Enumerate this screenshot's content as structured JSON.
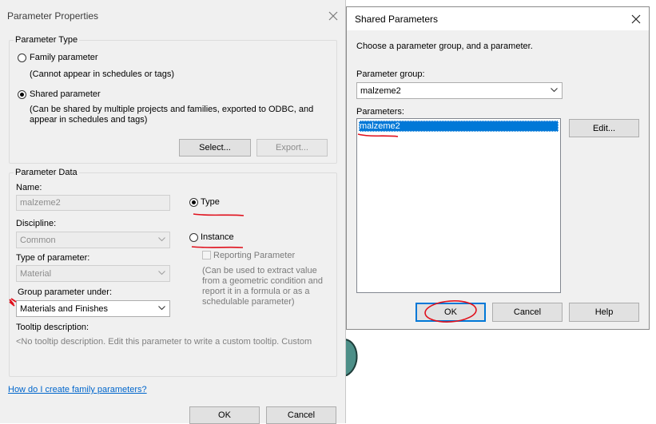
{
  "parameter_properties": {
    "title": "Parameter Properties",
    "parameter_type": {
      "legend": "Parameter Type",
      "family_label": "Family parameter",
      "family_note": "(Cannot appear in schedules or tags)",
      "shared_label": "Shared parameter",
      "shared_note_line1": "(Can be shared by multiple projects and families, exported to ODBC, and",
      "shared_note_line2": "appear in schedules and tags)",
      "selected": "shared",
      "select_button": "Select...",
      "export_button": "Export..."
    },
    "parameter_data": {
      "legend": "Parameter Data",
      "name_label": "Name:",
      "name_value": "malzeme2",
      "discipline_label": "Discipline:",
      "discipline_value": "Common",
      "type_of_parameter_label": "Type of parameter:",
      "type_of_parameter_value": "Material",
      "group_under_label": "Group parameter under:",
      "group_under_value": "Materials and Finishes",
      "tooltip_label": "Tooltip description:",
      "tooltip_value": "<No tooltip description. Edit this parameter to write a custom tooltip. Custom",
      "type_label": "Type",
      "instance_label": "Instance",
      "selected": "type",
      "reporting_label": "Reporting Parameter",
      "reporting_note_line1": "(Can be used to extract value",
      "reporting_note_line2": "from a geometric condition and",
      "reporting_note_line3": "report it in a formula or as a",
      "reporting_note_line4": "schedulable parameter)"
    },
    "help_link": "How do I create family parameters?",
    "ok_button": "OK",
    "cancel_button": "Cancel"
  },
  "shared_parameters": {
    "title": "Shared Parameters",
    "instruction": "Choose a parameter group, and a parameter.",
    "group_label": "Parameter group:",
    "group_value": "malzeme2",
    "parameters_label": "Parameters:",
    "parameters": [
      "malzeme2"
    ],
    "selected_index": 0,
    "edit_button": "Edit...",
    "ok_button": "OK",
    "cancel_button": "Cancel",
    "help_button": "Help"
  },
  "colors": {
    "selection": "#0078d7",
    "annotation": "#e0101c",
    "link": "#0066cc"
  }
}
